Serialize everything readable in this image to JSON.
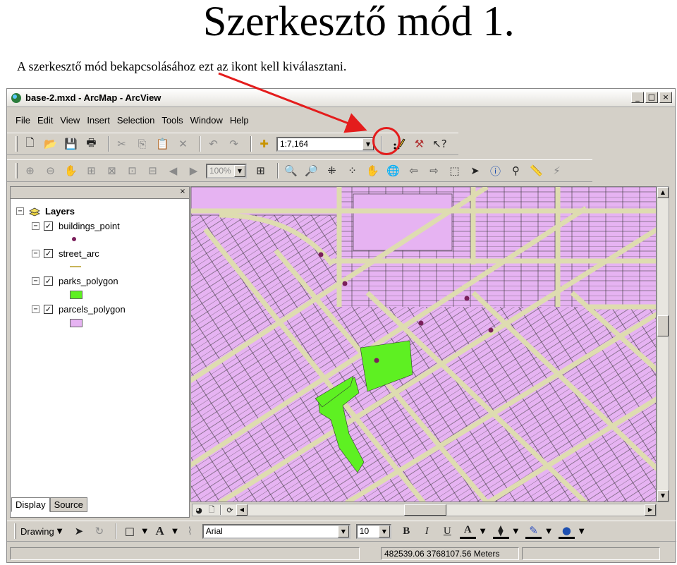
{
  "slide": {
    "title": "Szerkesztő mód 1.",
    "subtitle": "A szerkesztő mód bekapcsolásához ezt az ikont kell kiválasztani."
  },
  "window": {
    "title": "base-2.mxd - ArcMap - ArcView",
    "min_label": "_",
    "max_label": "□",
    "close_label": "×"
  },
  "menu": [
    "File",
    "Edit",
    "View",
    "Insert",
    "Selection",
    "Tools",
    "Window",
    "Help"
  ],
  "standard_toolbar": {
    "scale_value": "1:7,164",
    "editor_icon": "editor-toolbar-icon"
  },
  "tools_toolbar": {
    "zoom_value": "100%"
  },
  "toc": {
    "root": "Layers",
    "layers": [
      {
        "name": "buildings_point",
        "symbol": "point",
        "color": "#7b1f5c"
      },
      {
        "name": "street_arc",
        "symbol": "line",
        "color": "#c8b45a"
      },
      {
        "name": "parks_polygon",
        "symbol": "polygon",
        "color": "#5ef022"
      },
      {
        "name": "parcels_polygon",
        "symbol": "polygon",
        "color": "#e6b3f2"
      }
    ],
    "tab_display": "Display",
    "tab_source": "Source",
    "close_label": "×"
  },
  "draw_toolbar": {
    "drawing_label": "Drawing",
    "font_name": "Arial",
    "font_size": "10",
    "bold": "B",
    "italic": "I",
    "underline": "U",
    "font_color_letter": "A",
    "text_tool_letter": "A"
  },
  "status": {
    "coords": "482539.06  3768107.56 Meters"
  },
  "colors": {
    "parcel": "#e6b3f2",
    "street": "#dedcb0",
    "park": "#5ef022",
    "point": "#7b1f5c",
    "highlight": "#e41c1c"
  }
}
